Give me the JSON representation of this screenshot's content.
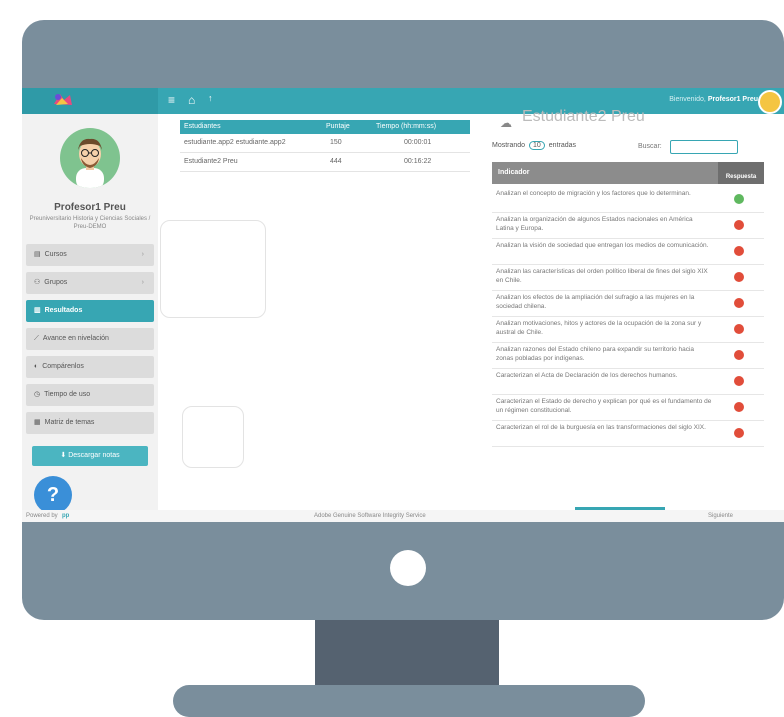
{
  "topbar": {
    "welcome_prefix": "Bienvenido,",
    "welcome_name": "Profesor1 Preu",
    "menu_icon": "hamburger-icon",
    "home_icon": "home-icon"
  },
  "profile": {
    "name": "Profesor1 Preu",
    "subtitle": "Preuniversitario Historia y Ciencias Sociales / Preu-DEMO"
  },
  "sidebar": {
    "items": [
      {
        "label": "Cursos",
        "icon": "book-icon",
        "has_chevron": true
      },
      {
        "label": "Grupos",
        "icon": "group-icon",
        "has_chevron": true
      },
      {
        "label": "Resultados",
        "icon": "chart-icon",
        "active": true
      },
      {
        "label": "Avance en nivelación",
        "icon": "line-chart-icon"
      },
      {
        "label": "Compárenlos",
        "icon": "compare-icon"
      },
      {
        "label": "Tiempo de uso",
        "icon": "clock-icon"
      },
      {
        "label": "Matriz de temas",
        "icon": "grid-icon"
      }
    ],
    "download_label": "Descargar notas",
    "help_label": "?"
  },
  "students_table": {
    "headers": [
      "Estudiantes",
      "Puntaje",
      "Tiempo (hh:mm:ss)"
    ],
    "rows": [
      {
        "name": "estudiante.app2 estudiante.app2",
        "score": "150",
        "time": "00:00:01"
      },
      {
        "name": "Estudiante2 Preu",
        "score": "444",
        "time": "00:16:22"
      }
    ]
  },
  "detail_panel": {
    "title": "Estudiante2 Preu",
    "showing_label": "Mostrando",
    "entries_value": "10",
    "entries_label": "entradas",
    "search_label": "Buscar:",
    "col_indicator": "Indicador",
    "col_response": "Respuesta",
    "rows": [
      {
        "text": "Analizan el concepto de migración y los factores que lo determinan.",
        "ok": true
      },
      {
        "text": "Analizan la organización de algunos Estados nacionales en América Latina y Europa.",
        "ok": false
      },
      {
        "text": "Analizan la visión de sociedad que entregan los medios de comunicación.",
        "ok": false
      },
      {
        "text": "Analizan las características del orden político liberal de fines del siglo XIX en Chile.",
        "ok": false
      },
      {
        "text": "Analizan los efectos de la ampliación del sufragio a las mujeres en la sociedad chilena.",
        "ok": false
      },
      {
        "text": "Analizan motivaciones, hitos y actores de la ocupación de la zona sur y austral de Chile.",
        "ok": false
      },
      {
        "text": "Analizan razones del Estado chileno para expandir su territorio hacia zonas pobladas por indígenas.",
        "ok": false
      },
      {
        "text": "Caracterizan el Acta de Declaración de los derechos humanos.",
        "ok": false
      },
      {
        "text": "Caracterizan el Estado de derecho y explican por qué es el fundamento de un régimen constitucional.",
        "ok": false
      },
      {
        "text": "Caracterizan el rol de la burguesía en las transformaciones del siglo XIX.",
        "ok": false
      }
    ],
    "next_label": "Siguiente"
  },
  "footer": {
    "powered_by": "Powered by",
    "brand": "pp",
    "notice": "Adobe Genuine Software Integrity Service"
  },
  "colors": {
    "accent": "#37a6b3",
    "monitor": "#7a8e9c",
    "stand": "#556270",
    "error_dot": "#e14d3a",
    "ok_dot": "#5fb85f"
  }
}
